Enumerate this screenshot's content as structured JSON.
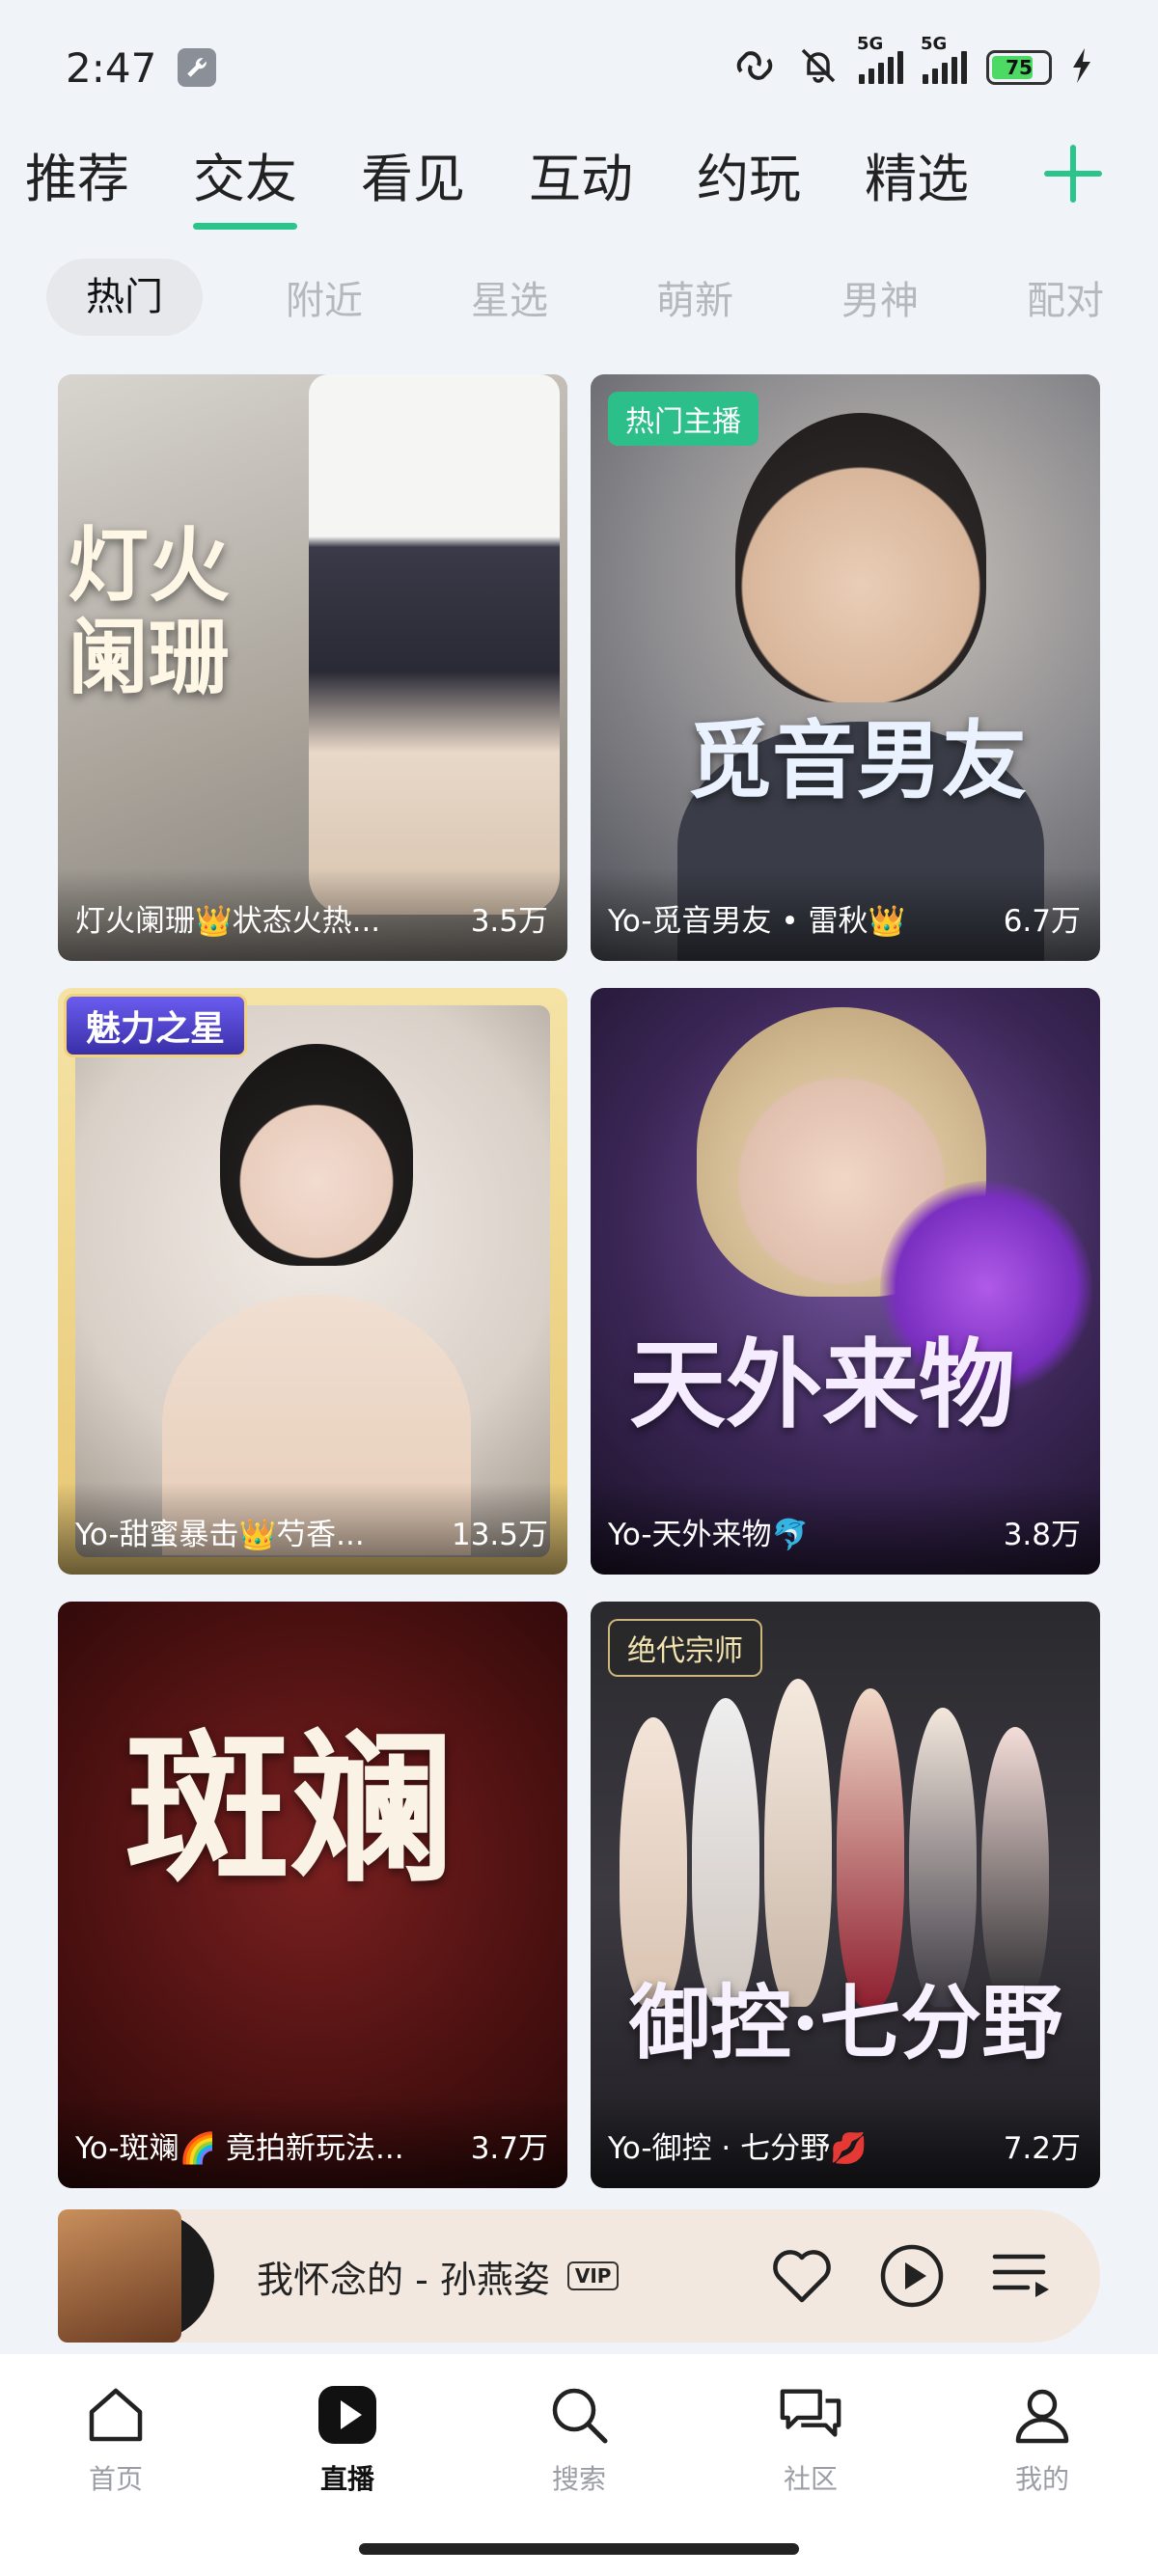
{
  "status_bar": {
    "time": "2:47",
    "network_1": "5G",
    "network_2": "5G",
    "battery": "75"
  },
  "top_tabs": [
    {
      "label": "推荐"
    },
    {
      "label": "交友"
    },
    {
      "label": "看见"
    },
    {
      "label": "互动"
    },
    {
      "label": "约玩"
    },
    {
      "label": "精选"
    }
  ],
  "top_tabs_active": "交友",
  "sub_tabs": [
    {
      "label": "热门"
    },
    {
      "label": "附近"
    },
    {
      "label": "星选"
    },
    {
      "label": "萌新"
    },
    {
      "label": "男神"
    },
    {
      "label": "配对"
    }
  ],
  "cards": [
    {
      "name": "灯火阑珊👑状态火热...",
      "count": "3.5万",
      "badge": "",
      "poster_text": "灯火阑珊"
    },
    {
      "name": "Yo-觅音男友 • 雷秋👑",
      "count": "6.7万",
      "badge": "热门主播",
      "poster_text": "觅音男友"
    },
    {
      "name": "Yo-甜蜜暴击👑芍香...",
      "count": "13.5万",
      "badge": "魅力之星",
      "poster_text": ""
    },
    {
      "name": "Yo-天外来物🐬",
      "count": "3.8万",
      "badge": "",
      "poster_text": "天外来物"
    },
    {
      "name": "Yo-斑斓🌈 竟拍新玩法...",
      "count": "3.7万",
      "badge": "",
      "poster_text": "斑斓"
    },
    {
      "name": "Yo-御控 · 七分野💋",
      "count": "7.2万",
      "badge": "绝代宗师",
      "poster_text": "御控·七分野"
    }
  ],
  "player": {
    "song": "我怀念的 - 孙燕姿",
    "vip_label": "VIP"
  },
  "bottom_nav": [
    {
      "label": "首页"
    },
    {
      "label": "直播"
    },
    {
      "label": "搜索"
    },
    {
      "label": "社区"
    },
    {
      "label": "我的"
    }
  ],
  "bottom_nav_active": "直播",
  "colors": {
    "accent": "#2bc48a",
    "background": "#f0f4f8"
  }
}
